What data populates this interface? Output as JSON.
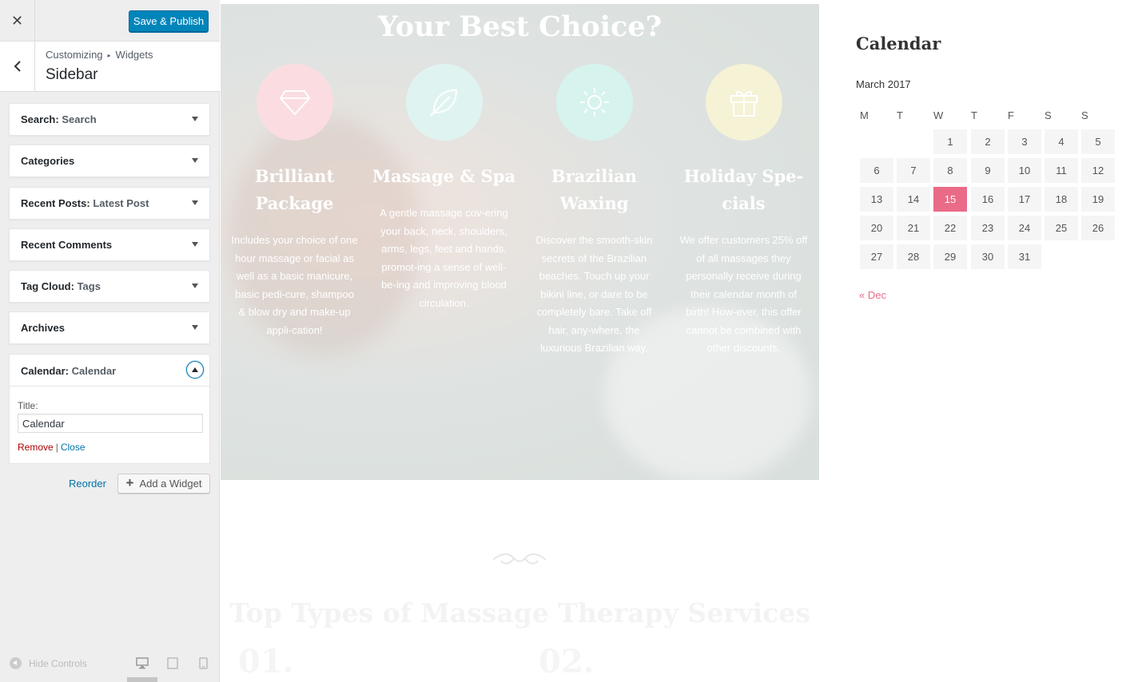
{
  "customizer": {
    "close_symbol": "✕",
    "publish_label": "Save & Publish",
    "breadcrumb": {
      "root": "Customizing",
      "separator": "▸",
      "parent": "Widgets"
    },
    "section_title": "Sidebar",
    "widgets": [
      {
        "name": "Search",
        "sub": "Search"
      },
      {
        "name": "Categories",
        "sub": ""
      },
      {
        "name": "Recent Posts",
        "sub": "Latest Post"
      },
      {
        "name": "Recent Comments",
        "sub": ""
      },
      {
        "name": "Tag Cloud",
        "sub": "Tags"
      },
      {
        "name": "Archives",
        "sub": ""
      }
    ],
    "colon": ":",
    "open_widget": {
      "name": "Calendar",
      "sub": "Calendar",
      "title_label": "Title:",
      "title_value": "Calendar",
      "remove_label": "Remove",
      "separator": "|",
      "close_label": "Close"
    },
    "reorder_label": "Reorder",
    "add_widget_label": "Add a Widget",
    "add_widget_symbol": "+",
    "hide_controls_label": "Hide Controls"
  },
  "preview": {
    "hero_heading": "Your Best Choice?",
    "services": [
      {
        "icon": "diamond-icon",
        "color": "#fbdde1",
        "title": "Brilliant Package",
        "description": "Includes your choice of one hour massage or facial as well as a basic manicure, basic pedi-cure, shampoo & blow dry and make-up appli-cation!"
      },
      {
        "icon": "leaf-icon",
        "color": "#dff4f1",
        "title": "Massage & Spa",
        "description": "A gentle massage cov-ering your back, neck, shoulders, arms, legs, feet and hands, promot-ing a sense of well-be-ing and improving blood circulation."
      },
      {
        "icon": "sun-icon",
        "color": "#d7f3ee",
        "title": "Brazilian Waxing",
        "description": "Discover the smooth-skin secrets of the Brazilian beaches. Touch up your bikini line, or dare to be completely bare. Take off hair, any-where, the luxurious Brazilian way."
      },
      {
        "icon": "gift-icon",
        "color": "#f6f2d6",
        "title": "Holiday Spe-cials",
        "description": "We offer customers 25% off of all massages they personally receive during their calendar month of birth! How-ever, this offer cannot be combined with other discounts."
      }
    ],
    "bottom_heading": "Top Types of Massage Therapy Services",
    "numbers": [
      "01.",
      "02."
    ]
  },
  "calendar": {
    "heading": "Calendar",
    "caption": "March 2017",
    "weekdays": [
      "M",
      "T",
      "W",
      "T",
      "F",
      "S",
      "S"
    ],
    "first_weekday_index": 2,
    "days_in_month": 31,
    "today": 15,
    "prev_link": "« Dec",
    "accent": "#ea6b88"
  }
}
